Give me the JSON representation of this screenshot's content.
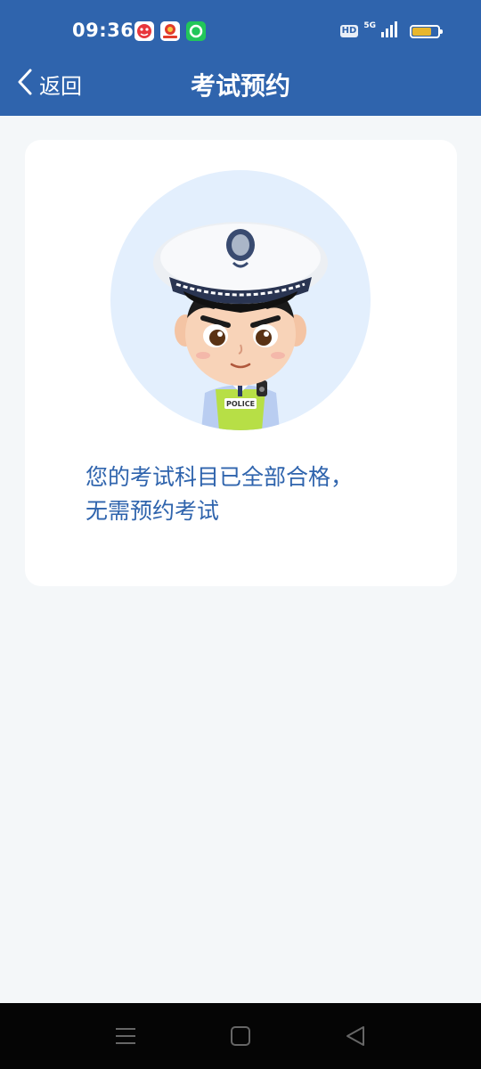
{
  "status_bar": {
    "time": "09:36",
    "hd_label": "HD",
    "network_label": "5G",
    "battery_level": 0.75,
    "icons": [
      "app-red-icon",
      "app-emblem-icon",
      "app-green-icon",
      "signal-icon",
      "battery-icon"
    ]
  },
  "header": {
    "back_label": "返回",
    "title": "考试预约",
    "background_color": "#2f64ad"
  },
  "card": {
    "illustration": "police-officer-avatar",
    "message_line1": "您的考试科目已全部合格，",
    "message_line2": "无需预约考试",
    "message_color": "#2f64ad"
  },
  "nav_bar": {
    "buttons": [
      "menu-icon",
      "home-icon",
      "back-triangle-icon"
    ]
  }
}
